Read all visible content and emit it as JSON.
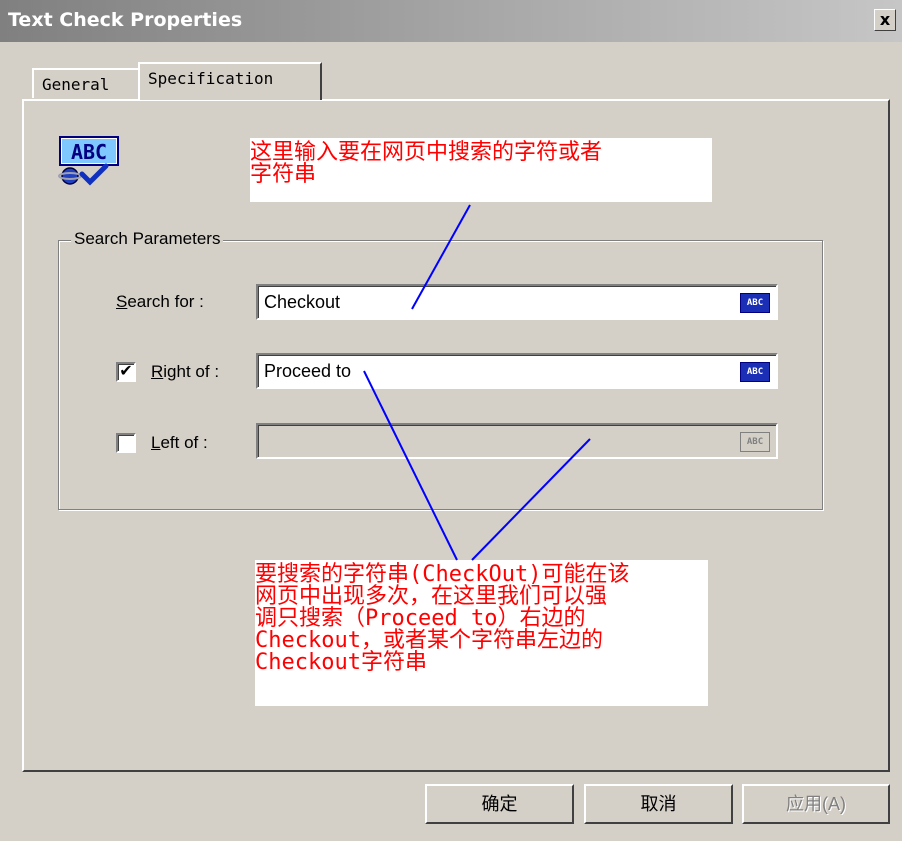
{
  "window": {
    "title": "Text Check Properties",
    "close_glyph": "x"
  },
  "tabs": [
    {
      "label": "General"
    },
    {
      "label": "Specification"
    }
  ],
  "icon": {
    "name": "abc-check-icon",
    "text": "ABC"
  },
  "group": {
    "legend": "Search Parameters",
    "search_for": {
      "mnemonic": "S",
      "label_rest": "earch for :",
      "value": "Checkout"
    },
    "right_of": {
      "checked": true,
      "check_glyph": "✔",
      "mnemonic": "R",
      "label_rest": "ight of :",
      "value": "Proceed to"
    },
    "left_of": {
      "checked": false,
      "check_glyph": "",
      "mnemonic": "L",
      "label_rest": "eft of  :",
      "value": ""
    },
    "abc_button_text": "ABC"
  },
  "notes": {
    "top": "这里输入要在网页中搜索的字符或者\n字符串",
    "bottom": "要搜索的字符串(CheckOut)可能在该\n网页中出现多次，在这里我们可以强\n调只搜索（Proceed to）右边的\nCheckout，或者某个字符串左边的\nCheckout字符串"
  },
  "buttons": {
    "ok": "确定",
    "cancel": "取消",
    "apply": "应用(A)"
  },
  "colors": {
    "annotation_text": "#ff0000",
    "annotation_line": "#0000ff",
    "dialog_face": "#d4d0c8"
  }
}
